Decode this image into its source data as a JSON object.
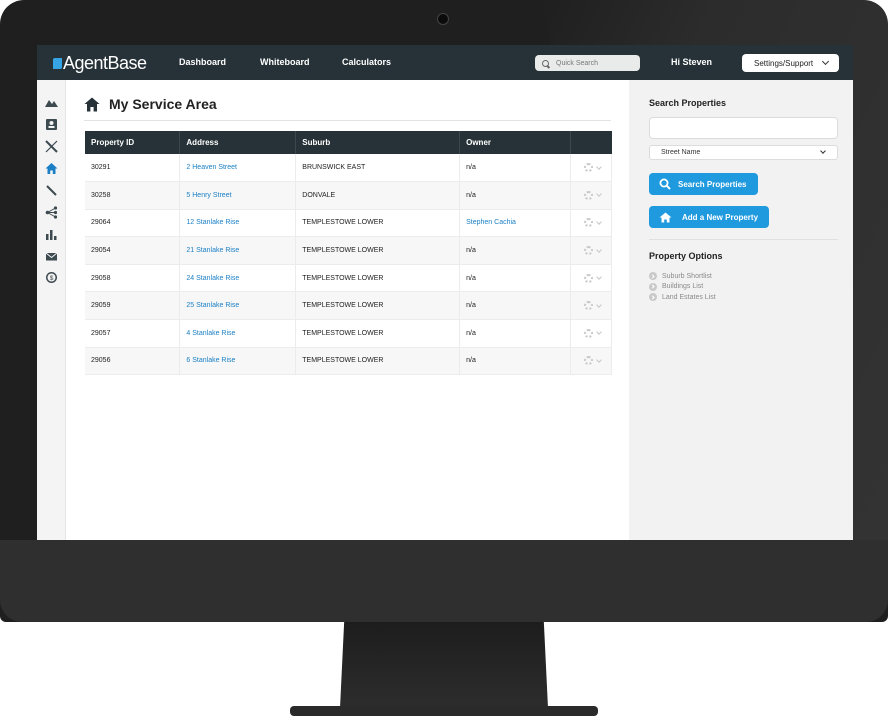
{
  "app": {
    "logo_text": "AgentBase",
    "nav": [
      "Dashboard",
      "Whiteboard",
      "Calculators"
    ],
    "quick_search_placeholder": "Quick Search",
    "greeting": "Hi Steven",
    "settings_label": "Settings/Support"
  },
  "rail": {
    "icons": [
      "mountain-icon",
      "contact-card-icon",
      "tools-icon",
      "home-icon",
      "pencil-icon",
      "network-icon",
      "bar-chart-icon",
      "mail-icon",
      "dollar-coin-icon"
    ],
    "active_icon": "home-icon",
    "active_color": "#1a7fc4"
  },
  "main": {
    "title": "My Service Area",
    "columns": [
      "Property ID",
      "Address",
      "Suburb",
      "Owner",
      ""
    ],
    "rows": [
      {
        "id": "30291",
        "address": "2 Heaven Street",
        "suburb": "BRUNSWICK EAST",
        "owner": "n/a"
      },
      {
        "id": "30258",
        "address": "5 Henry Street",
        "suburb": "DONVALE",
        "owner": "n/a"
      },
      {
        "id": "29064",
        "address": "12 Stanlake Rise",
        "suburb": "TEMPLESTOWE LOWER",
        "owner": "Stephen Cachia"
      },
      {
        "id": "29054",
        "address": "21 Stanlake Rise",
        "suburb": "TEMPLESTOWE LOWER",
        "owner": "n/a"
      },
      {
        "id": "29058",
        "address": "24 Stanlake Rise",
        "suburb": "TEMPLESTOWE LOWER",
        "owner": "n/a"
      },
      {
        "id": "29059",
        "address": "25 Stanlake Rise",
        "suburb": "TEMPLESTOWE LOWER",
        "owner": "n/a"
      },
      {
        "id": "29057",
        "address": "4 Stanlake Rise",
        "suburb": "TEMPLESTOWE LOWER",
        "owner": "n/a"
      },
      {
        "id": "29056",
        "address": "6 Stanlake Rise",
        "suburb": "TEMPLESTOWE LOWER",
        "owner": "n/a"
      }
    ]
  },
  "sidebar": {
    "search_heading": "Search Properties",
    "search_input_value": "",
    "search_by_selected": "Street Name",
    "search_button": "Search Properties",
    "add_button": "Add a New Property",
    "options_heading": "Property Options",
    "options": [
      "Suburb Shortlist",
      "Buildings List",
      "Land Estates List"
    ]
  },
  "colors": {
    "topbar": "#263238",
    "accent": "#1f9ade",
    "link": "#1a7fc4"
  }
}
